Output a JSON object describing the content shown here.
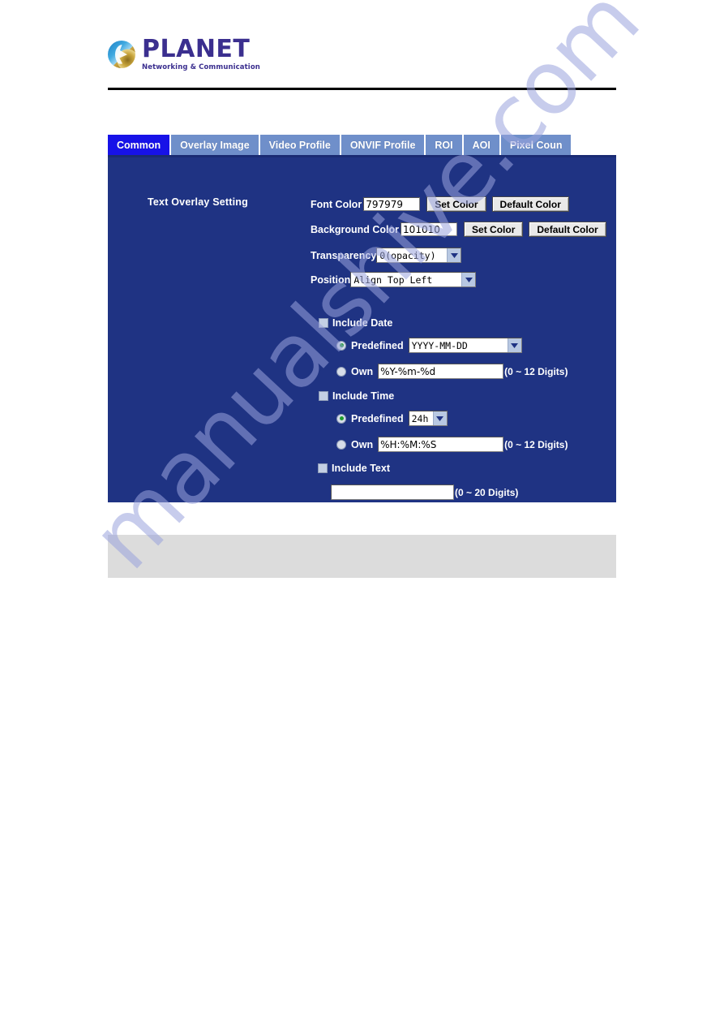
{
  "header": {
    "logo_word": "PLANET",
    "logo_tagline": "Networking & Communication"
  },
  "tabs": [
    {
      "label": "Common",
      "active": true
    },
    {
      "label": "Overlay Image",
      "active": false
    },
    {
      "label": "Video Profile",
      "active": false
    },
    {
      "label": "ONVIF Profile",
      "active": false
    },
    {
      "label": "ROI",
      "active": false
    },
    {
      "label": "AOI",
      "active": false
    },
    {
      "label": "Pixel Coun",
      "active": false
    }
  ],
  "panel": {
    "section_title": "Text Overlay Setting",
    "font_color": {
      "label": "Font Color",
      "value": "797979",
      "set_button": "Set Color",
      "default_button": "Default Color"
    },
    "background_color": {
      "label": "Background Color",
      "value": "101010",
      "set_button": "Set Color",
      "default_button": "Default Color"
    },
    "transparency": {
      "label": "Transparency",
      "value": "0(opacity)"
    },
    "position": {
      "label": "Position",
      "value": "Align Top Left"
    },
    "include_date": {
      "checkbox_label": "Include Date",
      "checked": false,
      "predefined_label": "Predefined",
      "predefined_selected": true,
      "predefined_value": "YYYY-MM-DD",
      "own_label": "Own",
      "own_selected": false,
      "own_value": "%Y-%m-%d",
      "hint": "(0 ~ 12 Digits)"
    },
    "include_time": {
      "checkbox_label": "Include Time",
      "checked": false,
      "predefined_label": "Predefined",
      "predefined_selected": true,
      "predefined_value": "24h",
      "own_label": "Own",
      "own_selected": false,
      "own_value": "%H:%M:%S",
      "hint": "(0 ~ 12 Digits)"
    },
    "include_text": {
      "checkbox_label": "Include Text",
      "checked": false,
      "value": "",
      "hint": "(0 ~ 20 Digits)"
    }
  },
  "watermark": {
    "text": "manualshive.com"
  },
  "colors": {
    "panel_blue": "#1f3383",
    "tab_active": "#1712e8",
    "tab_inactive": "#6f8fca",
    "gray_bar": "#dcdcdc",
    "logo_purple": "#3b2f8f"
  }
}
